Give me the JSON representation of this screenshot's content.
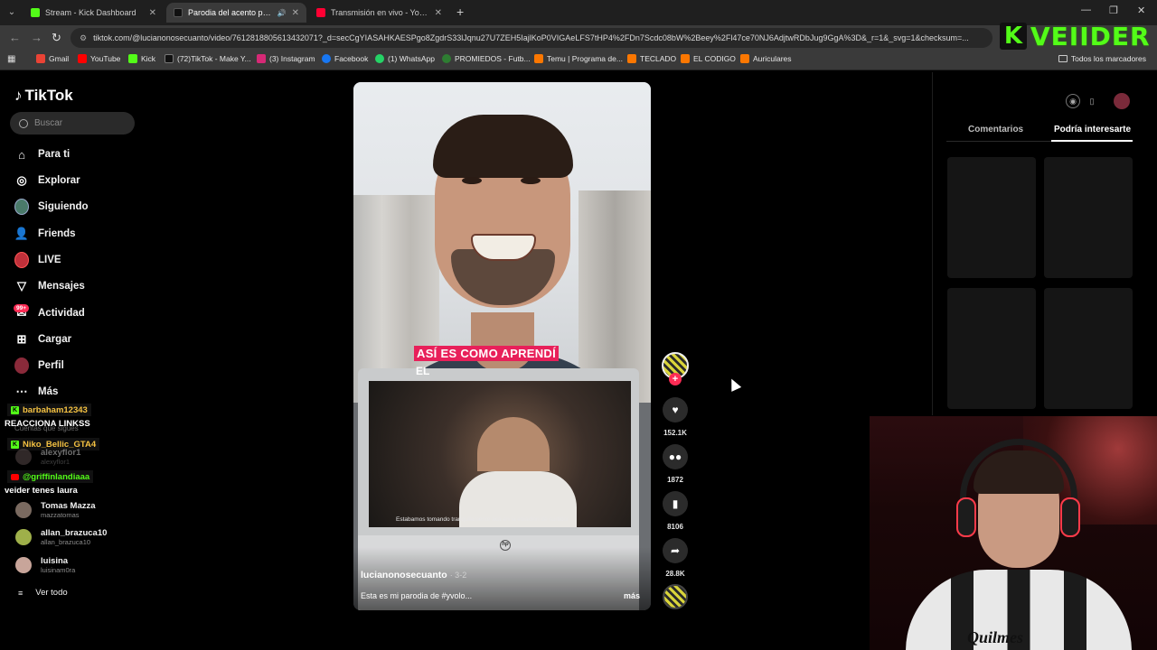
{
  "browser": {
    "tabs": [
      {
        "title": "Stream - Kick Dashboard",
        "color": "#53fc18",
        "active": false
      },
      {
        "title": "Parodia del acento paragua",
        "color": "#111111",
        "active": true
      },
      {
        "title": "Transmisión en vivo - YouTube",
        "color": "#ff0033",
        "active": false
      }
    ],
    "url": "tiktok.com/@lucianonosecuanto/video/7612818805613432071?_d=secCgYIASAHKAESPgo8ZgdrS33lJqnu27U7ZEH5IajlKoP0VIGAeLFS7tHP4%2FDn7Scdc08bW%2Beey%2Fl47ce70NJ6AdjtwRDbJug9GgA%3D&_r=1&_svg=1&checksum=...",
    "bookmarks": [
      {
        "label": "Gmail",
        "color": "#ea4335"
      },
      {
        "label": "YouTube",
        "color": "#ff0000"
      },
      {
        "label": "Kick",
        "color": "#53fc18"
      },
      {
        "label": "(72)TikTok - Make Y...",
        "color": "#111111"
      },
      {
        "label": "(3) Instagram",
        "color": "#d62976"
      },
      {
        "label": "Facebook",
        "color": "#1877f2"
      },
      {
        "label": "(1) WhatsApp",
        "color": "#25d366"
      },
      {
        "label": "PROMIEDOS - Futb...",
        "color": "#2e7d32"
      },
      {
        "label": "Temu | Programa de...",
        "color": "#fb7701"
      },
      {
        "label": "TECLADO",
        "color": "#fb7701"
      },
      {
        "label": "EL CODIGO",
        "color": "#fb7701"
      },
      {
        "label": "Auriculares",
        "color": "#fb7701"
      }
    ],
    "all_bookmarks": "Todos los marcadores"
  },
  "overlay": {
    "kick_letter": "K",
    "streamer_name": "VEIIDER",
    "kick_color": "#53fc18"
  },
  "tiktok": {
    "logo": "TikTok",
    "search_placeholder": "Buscar",
    "nav": [
      {
        "label": "Para ti",
        "icon": "home-icon"
      },
      {
        "label": "Explorar",
        "icon": "compass-icon"
      },
      {
        "label": "Siguiendo",
        "icon": "following-avatar"
      },
      {
        "label": "Friends",
        "icon": "friends-icon"
      },
      {
        "label": "LIVE",
        "icon": "live-icon"
      },
      {
        "label": "Mensajes",
        "icon": "messages-icon"
      },
      {
        "label": "Actividad",
        "icon": "activity-icon"
      },
      {
        "label": "Cargar",
        "icon": "upload-icon"
      },
      {
        "label": "Perfil",
        "icon": "profile-icon"
      },
      {
        "label": "Más",
        "icon": "more-icon"
      }
    ],
    "activity_badge": "99+",
    "following_header": "Cuentas que sigues",
    "following": [
      {
        "name": "alexyflor1",
        "handle": "alexyflor1"
      },
      {
        "name": "Tomas Mazza",
        "handle": "mazzatomas"
      },
      {
        "name": "allan_brazuca10",
        "handle": "allan_brazuca10"
      },
      {
        "name": "luisina",
        "handle": "luisinam0ra"
      }
    ],
    "see_all": "Ver todo",
    "video": {
      "caption_highlight": "ASÍ ES COMO APRENDÍ",
      "caption_next": "EL",
      "laptop_subtitle": "Estabamos tomando tranquilamente aca en la estacion de surtidor",
      "laptop_brand": "hp",
      "author": "lucianonosecuanto",
      "date": "· 3-2",
      "description": "Esta es mi parodia de #yvolo...",
      "more": "más"
    },
    "actions": {
      "likes": "152.1K",
      "comments": "1872",
      "saves": "8106",
      "shares": "28.8K"
    },
    "right_panel": {
      "tab_comments": "Comentarios",
      "tab_suggested": "Podría interesarte"
    }
  },
  "chat_overlay": [
    {
      "user": "barbaham12343",
      "platform": "kick",
      "color": "#f5c242"
    },
    {
      "message": "REACCIONA LINKSS"
    },
    {
      "user": "Niko_Bellic_GTA4",
      "platform": "kick",
      "color": "#f5c242"
    },
    {
      "user": "@griffinlandiaaa",
      "platform": "youtube",
      "color": "#53fc18"
    },
    {
      "message": "veider tenes laura"
    }
  ],
  "webcam": {
    "shirt_text": "Quilmes"
  }
}
